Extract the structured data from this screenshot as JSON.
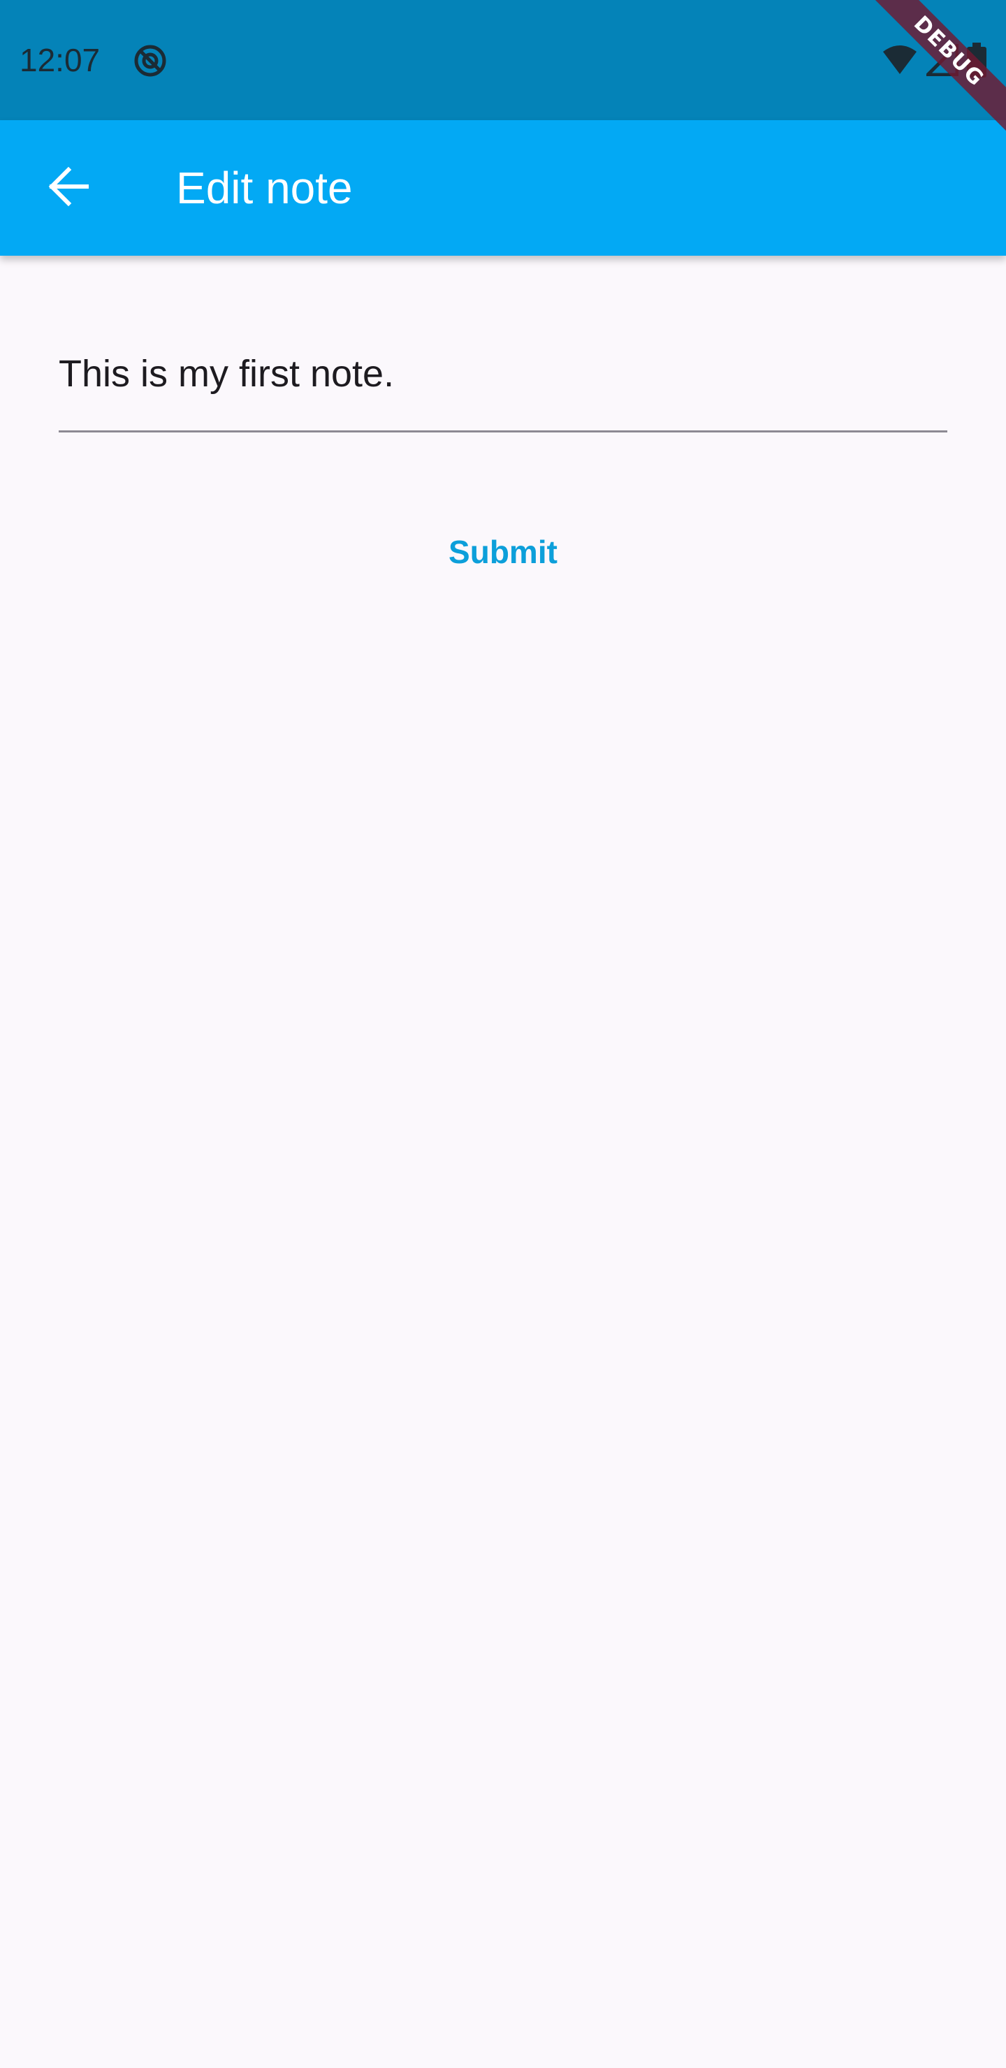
{
  "status_bar": {
    "time": "12:07",
    "icons": [
      "sync-disabled-icon",
      "wifi-icon",
      "signal-icon",
      "battery-icon"
    ]
  },
  "debug_banner": {
    "label": "DEBUG"
  },
  "app_bar": {
    "title": "Edit note",
    "back_icon": "arrow-back-icon",
    "background_color": "#03a9f4"
  },
  "form": {
    "note_value": "This is my first note.",
    "submit_label": "Submit",
    "accent_color": "#0c9fda"
  }
}
